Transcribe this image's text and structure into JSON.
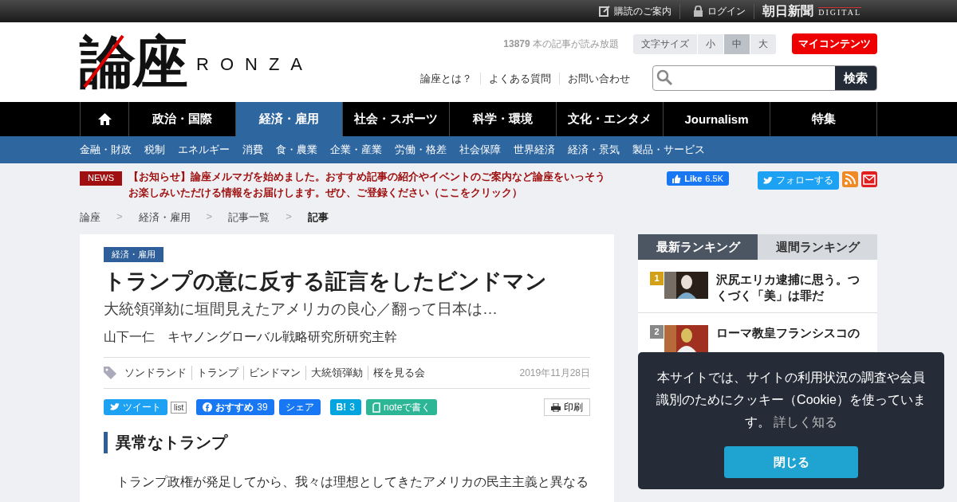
{
  "topbar": {
    "links": [
      {
        "kind": "edit",
        "label": "購読のご案内"
      },
      {
        "kind": "lock",
        "label": "ログイン"
      }
    ],
    "brand": "朝日新聞",
    "brand_sub": "DIGITAL"
  },
  "header": {
    "logo": "論座",
    "logo_sub": "RONZA",
    "article_count": "13879",
    "article_count_text": "本の記事が読み放題",
    "font_size_label": "文字サイズ",
    "font_sizes": [
      {
        "label": "小",
        "selected": false
      },
      {
        "label": "中",
        "selected": true
      },
      {
        "label": "大",
        "selected": false
      }
    ],
    "my_contents": "マイコンテンツ",
    "links": [
      "論座とは？",
      "よくある質問",
      "お問い合わせ"
    ],
    "search_button": "検索"
  },
  "nav": [
    {
      "kind": "home",
      "selected": false
    },
    {
      "kind": "text",
      "label": "政治・国際",
      "selected": false
    },
    {
      "kind": "text",
      "label": "経済・雇用",
      "selected": true
    },
    {
      "kind": "text",
      "label": "社会・スポーツ",
      "selected": false
    },
    {
      "kind": "text",
      "label": "科学・環境",
      "selected": false
    },
    {
      "kind": "text",
      "label": "文化・エンタメ",
      "selected": false
    },
    {
      "kind": "text",
      "label": "Journalism",
      "selected": false
    },
    {
      "kind": "text",
      "label": "特集",
      "selected": false
    }
  ],
  "subnav": [
    "金融・財政",
    "税制",
    "エネルギー",
    "消費",
    "食・農業",
    "企業・産業",
    "労働・格差",
    "社会保障",
    "世界経済",
    "経済・景気",
    "製品・サービス"
  ],
  "news": {
    "badge": "NEWS",
    "text": "【お知らせ】論座メルマガを始めました。おすすめ記事の紹介やイベントのご案内など論座をいっそうお楽しみいただける情報をお届けします。ぜひ、ご登録ください（ここをクリック）"
  },
  "social": {
    "like": "Like",
    "like_count": "6.5K",
    "follow": "フォローする"
  },
  "breadcrumb": [
    {
      "label": "論座",
      "selected": false
    },
    {
      "separator": ">",
      "label": "経済・雇用",
      "selected": false
    },
    {
      "separator": ">",
      "label": "記事一覧",
      "selected": false
    },
    {
      "separator": ">",
      "label": "記事",
      "selected": true
    }
  ],
  "article": {
    "category": "経済・雇用",
    "title": "トランプの意に反する証言をしたビンドマン",
    "subtitle": "大統領弾劾に垣間見えたアメリカの良心／翻って日本は…",
    "author": "山下一仁　キヤノングローバル戦略研究所研究主幹",
    "tags": [
      "ソンドランド",
      "トランプ",
      "ビンドマン",
      "大統領弾劾",
      "桜を見る会"
    ],
    "date": "2019年11月28日",
    "share": {
      "tweet": "ツイート",
      "list": "list",
      "recommend": "おすすめ",
      "recommend_count": "39",
      "share": "シェア",
      "hatena": "B!",
      "hatena_count": "3",
      "note": "noteで書く",
      "print": "印刷"
    },
    "heading": "異常なトランプ",
    "body": "　トランプ政権が発足してから、我々は理想としてきたアメリカの民主主義と異なる"
  },
  "ranking": {
    "tabs": [
      {
        "label": "最新ランキング",
        "selected": true
      },
      {
        "label": "週間ランキング",
        "selected": false
      }
    ],
    "items": [
      {
        "rank": "1",
        "color": "#d4a017",
        "title": "沢尻エリカ逮捕に思う。つくづく「美」は罪だ"
      },
      {
        "rank": "2",
        "color": "#888888",
        "title": "ローマ教皇フランシスコの"
      }
    ]
  },
  "cookie": {
    "text": "本サイトでは、サイトの利用状況の調査や会員識別のためにクッキー（Cookie）を使っています。",
    "link": "詳しく知る",
    "button": "閉じる"
  }
}
